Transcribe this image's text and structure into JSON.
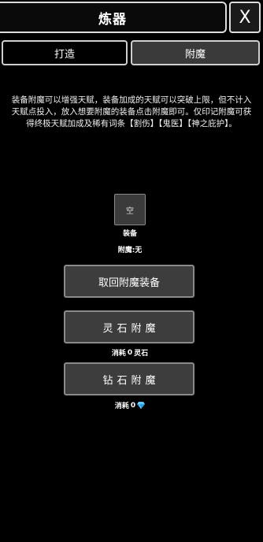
{
  "header": {
    "title": "炼器",
    "close_label": "X"
  },
  "tabs": [
    {
      "label": "打造",
      "active": false
    },
    {
      "label": "附魔",
      "active": true
    }
  ],
  "description": "装备附魔可以增强天赋，装备加成的天赋可以突破上限，但不计入天赋点投入，放入想要附魔的装备点击附魔即可。仅印记附魔可获得终极天赋加成及稀有词条【割伤】【鬼医】【神之庇护】。",
  "slot": {
    "empty_text": "空",
    "label": "装备",
    "enchant_status": "附魔:无"
  },
  "buttons": {
    "retrieve": "取回附魔装备",
    "spirit_stone_enchant": "灵石附魔",
    "diamond_enchant": "钻石附魔"
  },
  "costs": {
    "spirit_stone": {
      "prefix": "消耗",
      "amount": "0",
      "unit": "灵石"
    },
    "diamond": {
      "prefix": "消耗",
      "amount": "0",
      "icon": "diamond-icon"
    }
  },
  "colors": {
    "background": "#000000",
    "button": "#3d3d3d",
    "active_tab": "#3a3a3a",
    "diamond": "#5cc8ff"
  }
}
